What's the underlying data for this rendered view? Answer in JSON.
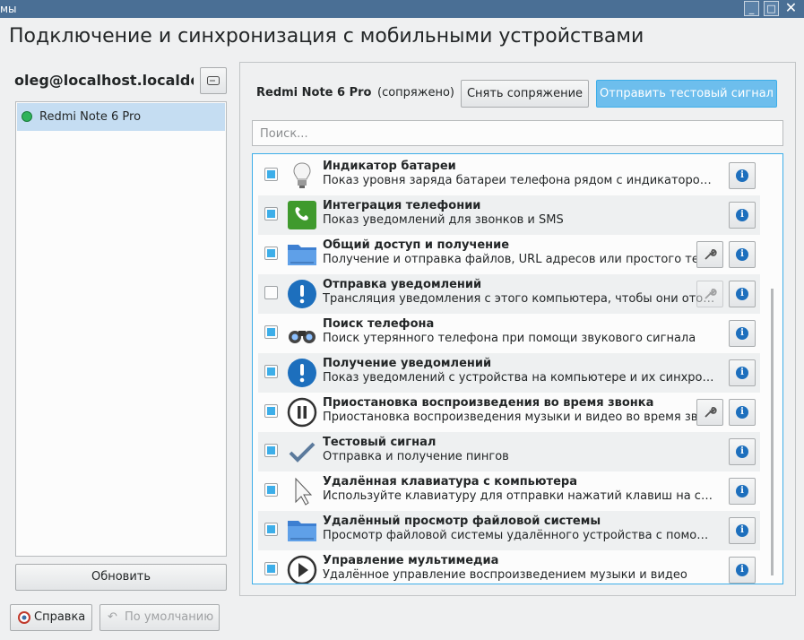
{
  "window": {
    "title_fragment": "мы",
    "buttons": [
      "_",
      "□",
      "✕"
    ]
  },
  "page_title": "Подключение и синхронизация с мобильными устройствами",
  "left": {
    "device_name": "oleg@localhost.localdomain",
    "devices": [
      {
        "name": "Redmi Note 6 Pro",
        "status_color": "#2fb35a",
        "selected": true
      }
    ],
    "refresh_label": "Обновить"
  },
  "right": {
    "paired_device": "Redmi Note 6 Pro",
    "paired_status": "(сопряжено)",
    "unpair_label": "Снять сопряжение",
    "ping_label": "Отправить тестовый сигнал",
    "search_placeholder": "Поиск...",
    "plugins": [
      {
        "title": "Индикатор батареи",
        "desc": "Показ уровня заряда батареи телефона рядом с индикатором батареи компьютера",
        "checked": true,
        "configure": "none",
        "icon": "lightbulb-icon"
      },
      {
        "title": "Интеграция телефонии",
        "desc": "Показ уведомлений для звонков и SMS",
        "checked": true,
        "configure": "none",
        "icon": "phone-icon"
      },
      {
        "title": "Общий доступ и получение",
        "desc": "Получение и отправка файлов, URL адресов или простого текста",
        "checked": true,
        "configure": "enabled",
        "icon": "folder-share-icon"
      },
      {
        "title": "Отправка уведомлений",
        "desc": "Трансляция уведомления с этого компьютера, чтобы они отображались на устройстве",
        "checked": false,
        "configure": "disabled",
        "icon": "notification-icon"
      },
      {
        "title": "Поиск телефона",
        "desc": "Поиск утерянного телефона при помощи звукового сигнала",
        "checked": true,
        "configure": "none",
        "icon": "binoculars-icon"
      },
      {
        "title": "Получение уведомлений",
        "desc": "Показ уведомлений с устройства на компьютере и их синхронизация",
        "checked": true,
        "configure": "none",
        "icon": "notification-icon"
      },
      {
        "title": "Приостановка воспроизведения во время звонка",
        "desc": "Приостановка воспроизведения музыки и видео во время звонка",
        "checked": true,
        "configure": "enabled",
        "icon": "pause-icon"
      },
      {
        "title": "Тестовый сигнал",
        "desc": "Отправка и получение пингов",
        "checked": true,
        "configure": "none",
        "icon": "checkmark-icon"
      },
      {
        "title": "Удалённая клавиатура с компьютера",
        "desc": "Используйте клавиатуру для отправки нажатий клавиш на сопряжённое устройство",
        "checked": true,
        "configure": "none",
        "icon": "pointer-icon"
      },
      {
        "title": "Удалённый просмотр файловой системы",
        "desc": "Просмотр файловой системы удалённого устройства с помощью Dolphin",
        "checked": true,
        "configure": "none",
        "icon": "folder-icon"
      },
      {
        "title": "Управление мультимедиа",
        "desc": "Удалённое управление воспроизведением музыки и видео",
        "checked": true,
        "configure": "none",
        "icon": "play-icon"
      }
    ]
  },
  "footer": {
    "help_label": "Справка",
    "defaults_label": "По умолчанию"
  }
}
